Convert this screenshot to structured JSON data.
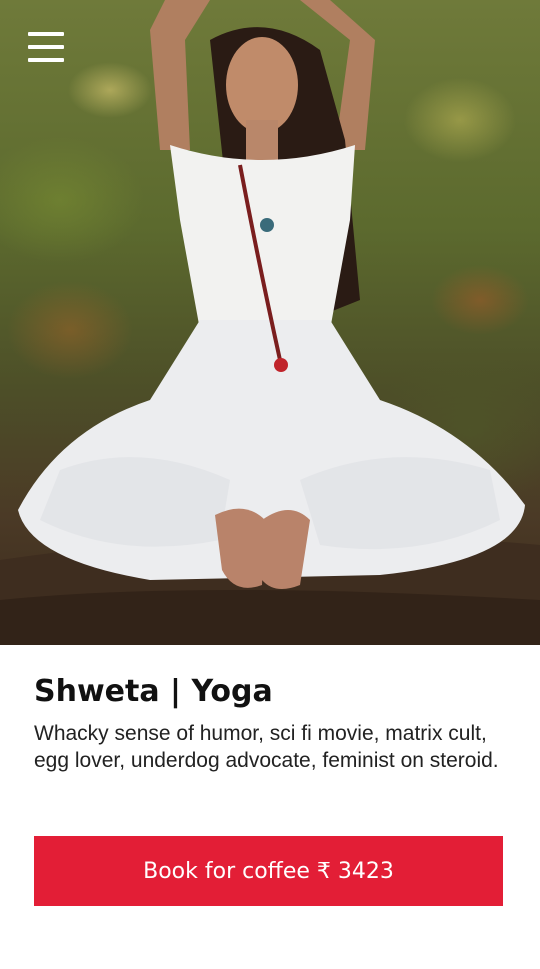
{
  "hero": {
    "image": "woman-meditating-yoga-pose-forest",
    "menu_icon": "hamburger-menu-icon"
  },
  "profile": {
    "title": "Shweta | Yoga",
    "description": "Whacky sense of humor, sci fi movie, matrix cult, egg lover, underdog advocate, feminist on steroid."
  },
  "cta": {
    "label": "Book for coffee ₹ 3423"
  },
  "colors": {
    "accent": "#e31e36",
    "title": "#111111",
    "body": "#222222",
    "background": "#ffffff"
  }
}
